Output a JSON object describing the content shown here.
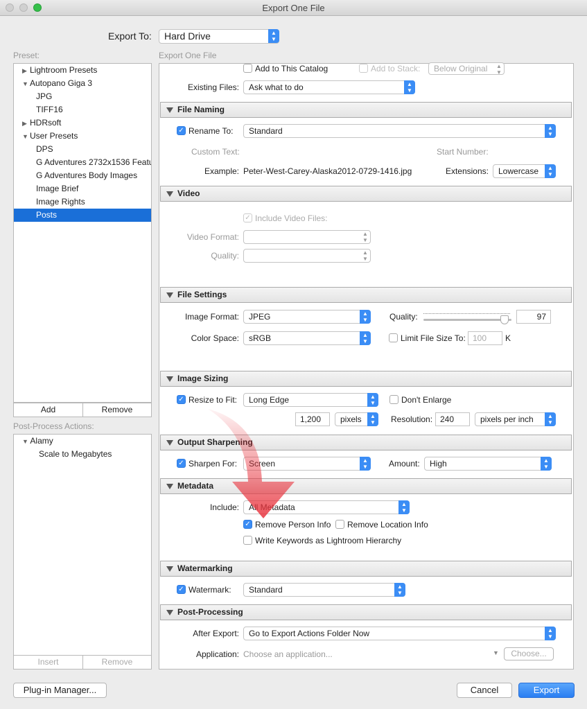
{
  "window": {
    "title": "Export One File"
  },
  "export_to": {
    "label": "Export To:",
    "value": "Hard Drive"
  },
  "preset": {
    "label": "Preset:",
    "items": [
      {
        "label": "Lightroom Presets",
        "type": "folder",
        "expanded": false
      },
      {
        "label": "Autopano Giga 3",
        "type": "folder",
        "expanded": true
      },
      {
        "label": "JPG",
        "type": "item"
      },
      {
        "label": "TIFF16",
        "type": "item"
      },
      {
        "label": "HDRsoft",
        "type": "folder",
        "expanded": false
      },
      {
        "label": "User Presets",
        "type": "folder",
        "expanded": true
      },
      {
        "label": "DPS",
        "type": "item"
      },
      {
        "label": "G Adventures 2732x1536 Featu",
        "type": "item"
      },
      {
        "label": "G Adventures Body Images",
        "type": "item"
      },
      {
        "label": "Image Brief",
        "type": "item"
      },
      {
        "label": "Image Rights",
        "type": "item"
      },
      {
        "label": "Posts",
        "type": "item",
        "selected": true
      }
    ],
    "add": "Add",
    "remove": "Remove"
  },
  "post_process": {
    "label": "Post-Process Actions:",
    "items": [
      {
        "label": "Alamy",
        "type": "folder"
      },
      {
        "label": "Scale to Megabytes",
        "type": "item"
      }
    ],
    "insert": "Insert",
    "remove": "Remove"
  },
  "panel_label": "Export One File",
  "location": {
    "add_catalog": "Add to This Catalog",
    "add_stack": "Add to Stack:",
    "stack_value": "Below Original",
    "existing_label": "Existing Files:",
    "existing_value": "Ask what to do"
  },
  "file_naming": {
    "title": "File Naming",
    "rename_label": "Rename To:",
    "rename_value": "Standard",
    "custom_text": "Custom Text:",
    "start_number": "Start Number:",
    "example_label": "Example:",
    "example_value": "Peter-West-Carey-Alaska2012-0729-1416.jpg",
    "ext_label": "Extensions:",
    "ext_value": "Lowercase"
  },
  "video": {
    "title": "Video",
    "include": "Include Video Files:",
    "format_label": "Video Format:",
    "quality_label": "Quality:"
  },
  "file_settings": {
    "title": "File Settings",
    "format_label": "Image Format:",
    "format_value": "JPEG",
    "quality_label": "Quality:",
    "quality_value": "97",
    "color_label": "Color Space:",
    "color_value": "sRGB",
    "limit_label": "Limit File Size To:",
    "limit_value": "100",
    "limit_unit": "K"
  },
  "image_sizing": {
    "title": "Image Sizing",
    "resize_label": "Resize to Fit:",
    "resize_value": "Long Edge",
    "dont_enlarge": "Don't Enlarge",
    "size_value": "1,200",
    "size_unit": "pixels",
    "res_label": "Resolution:",
    "res_value": "240",
    "res_unit": "pixels per inch"
  },
  "sharpening": {
    "title": "Output Sharpening",
    "sharpen_label": "Sharpen For:",
    "sharpen_value": "Screen",
    "amount_label": "Amount:",
    "amount_value": "High"
  },
  "metadata": {
    "title": "Metadata",
    "include_label": "Include:",
    "include_value": "All Metadata",
    "remove_person": "Remove Person Info",
    "remove_location": "Remove Location Info",
    "keywords": "Write Keywords as Lightroom Hierarchy"
  },
  "watermarking": {
    "title": "Watermarking",
    "label": "Watermark:",
    "value": "Standard"
  },
  "post_processing": {
    "title": "Post-Processing",
    "after_label": "After Export:",
    "after_value": "Go to Export Actions Folder Now",
    "app_label": "Application:",
    "app_placeholder": "Choose an application...",
    "choose": "Choose..."
  },
  "footer": {
    "plugin": "Plug-in Manager...",
    "cancel": "Cancel",
    "export": "Export"
  },
  "colors": {
    "accent": "#3b8df5",
    "selection": "#1a6fd8",
    "annotation_arrow": "#e8323c"
  }
}
